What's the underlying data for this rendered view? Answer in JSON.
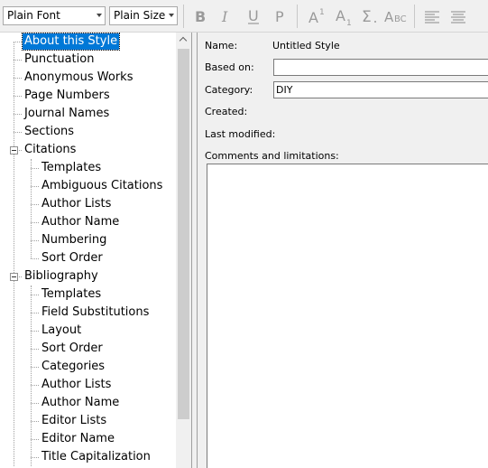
{
  "toolbar": {
    "font_value": "Plain Font",
    "size_value": "Plain Size",
    "buttons": [
      "bold-icon",
      "italic-icon",
      "underline-icon",
      "plain-icon",
      "superscript-icon",
      "subscript-icon",
      "symbol-icon",
      "small-caps-icon",
      "align-left-icon",
      "justify-icon"
    ]
  },
  "tree": {
    "root_items": [
      "About this Style",
      "Punctuation",
      "Anonymous Works",
      "Page Numbers",
      "Journal Names",
      "Sections"
    ],
    "citations": {
      "label": "Citations",
      "children": [
        "Templates",
        "Ambiguous Citations",
        "Author Lists",
        "Author Name",
        "Numbering",
        "Sort Order"
      ]
    },
    "bibliography": {
      "label": "Bibliography",
      "children": [
        "Templates",
        "Field Substitutions",
        "Layout",
        "Sort Order",
        "Categories",
        "Author Lists",
        "Author Name",
        "Editor Lists",
        "Editor Name",
        "Title Capitalization"
      ]
    }
  },
  "details": {
    "name_label": "Name:",
    "name_value": "Untitled Style",
    "based_on_label": "Based on:",
    "based_on_value": "",
    "category_label": "Category:",
    "category_value": "DIY",
    "created_label": "Created:",
    "modified_label": "Last modified:",
    "comments_label": "Comments and limitations:",
    "comments_value": ""
  },
  "colors": {
    "selection": "#0078d7",
    "disabled_icon": "#9a9a9a"
  }
}
